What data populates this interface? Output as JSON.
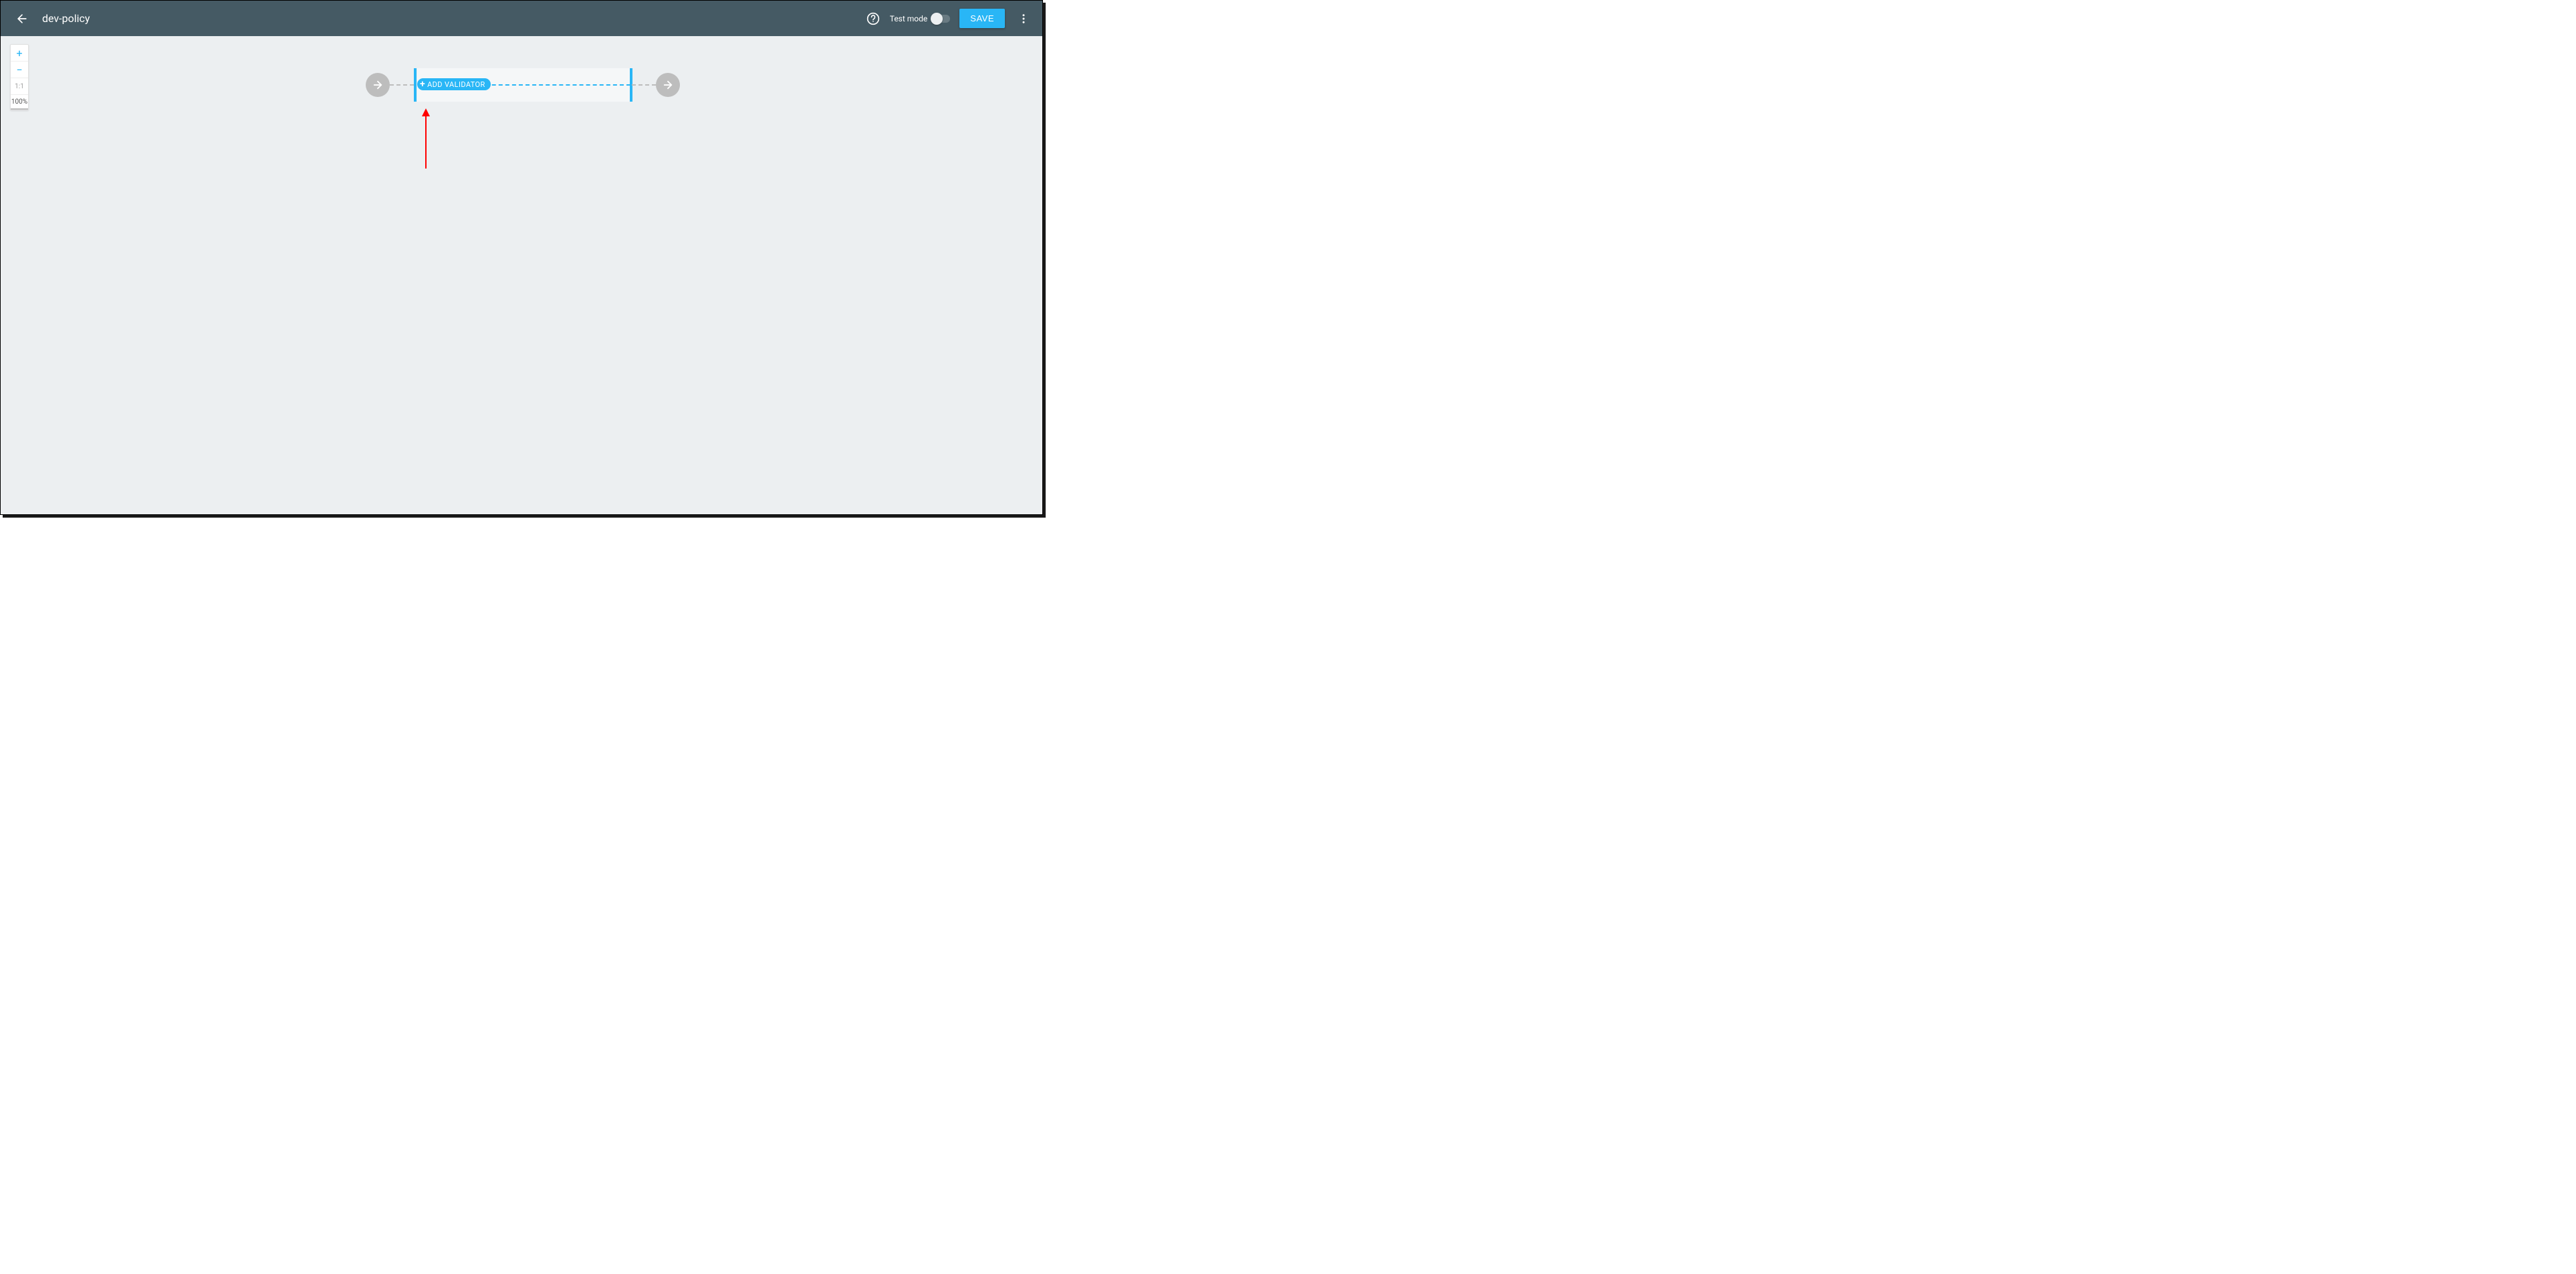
{
  "header": {
    "title": "dev-policy",
    "test_mode_label": "Test mode",
    "save_label": "SAVE"
  },
  "zoom": {
    "in": "+",
    "out": "−",
    "reset": "1:1",
    "level": "100%"
  },
  "flow": {
    "add_validator_label": "ADD VALIDATOR"
  },
  "colors": {
    "accent": "#29b6f6",
    "header_bg": "#455a64",
    "canvas_bg": "#eceff1",
    "node_grey": "#bdbdbd",
    "annotation": "#ff0000"
  }
}
